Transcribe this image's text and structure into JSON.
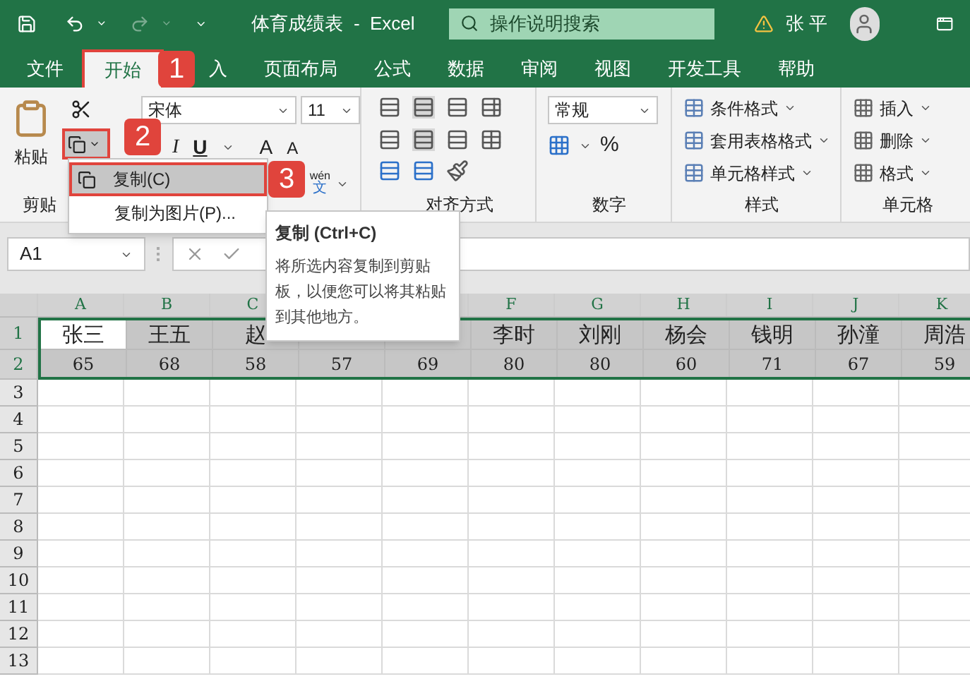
{
  "title_bar": {
    "title": "体育成绩表  -  Excel",
    "search": {
      "placeholder": "操作说明搜索"
    },
    "user": "张 平"
  },
  "ribbon_tabs": [
    {
      "label": "文件",
      "selected": false
    },
    {
      "label": "开始",
      "selected": true
    },
    {
      "label": "入",
      "selected": false
    },
    {
      "label": "页面布局",
      "selected": false
    },
    {
      "label": "公式",
      "selected": false
    },
    {
      "label": "数据",
      "selected": false
    },
    {
      "label": "审阅",
      "selected": false
    },
    {
      "label": "视图",
      "selected": false
    },
    {
      "label": "开发工具",
      "selected": false
    },
    {
      "label": "帮助",
      "selected": false
    }
  ],
  "clipboard": {
    "paste": "粘贴",
    "label": "剪贴"
  },
  "font": {
    "name": "宋体",
    "size": "11",
    "buttons": [
      "I",
      "U"
    ],
    "grow": "A",
    "shrink": "A",
    "phonetic_top": "wén",
    "phonetic_bottom": "文"
  },
  "alignment": {
    "label": "对齐方式"
  },
  "number": {
    "format": "常规",
    "percent": "%",
    "label": "数字"
  },
  "styles": {
    "items": [
      "条件格式",
      "套用表格格式",
      "单元格样式"
    ],
    "label": "样式"
  },
  "cells": {
    "items": [
      "插入",
      "删除",
      "格式"
    ],
    "label": "单元格"
  },
  "copy_menu": {
    "items": [
      {
        "label": "复制(C)",
        "selected": true
      },
      {
        "label": "复制为图片(P)...",
        "selected": false
      }
    ]
  },
  "tooltip": {
    "title": "复制 (Ctrl+C)",
    "body": "将所选内容复制到剪贴板，以便您可以将其粘贴到其他地方。"
  },
  "callouts": [
    "1",
    "2",
    "3"
  ],
  "formula_bar": {
    "name_box": "A1"
  },
  "sheet": {
    "columns_left": [
      "A",
      "B",
      "C"
    ],
    "columns_right": [
      "F",
      "G",
      "H",
      "I",
      "J",
      "K"
    ],
    "row_numbers": [
      "1",
      "2",
      "3",
      "4",
      "5",
      "6",
      "7",
      "8",
      "9",
      "10",
      "11",
      "12",
      "13"
    ],
    "row_1_left": [
      {
        "text": "张三",
        "active": true
      },
      {
        "text": "王五",
        "active": false
      },
      {
        "text": "赵",
        "active": false
      }
    ],
    "row_1_right": [
      {
        "text": "李时",
        "active": false
      },
      {
        "text": "刘刚",
        "active": false
      },
      {
        "text": "杨会",
        "active": false
      },
      {
        "text": "钱明",
        "active": false
      },
      {
        "text": "孙潼",
        "active": false
      },
      {
        "text": "周浩",
        "active": false
      }
    ],
    "row_2": [
      "65",
      "68",
      "58",
      "57",
      "69",
      "80",
      "80",
      "60",
      "71",
      "67",
      "59"
    ]
  }
}
